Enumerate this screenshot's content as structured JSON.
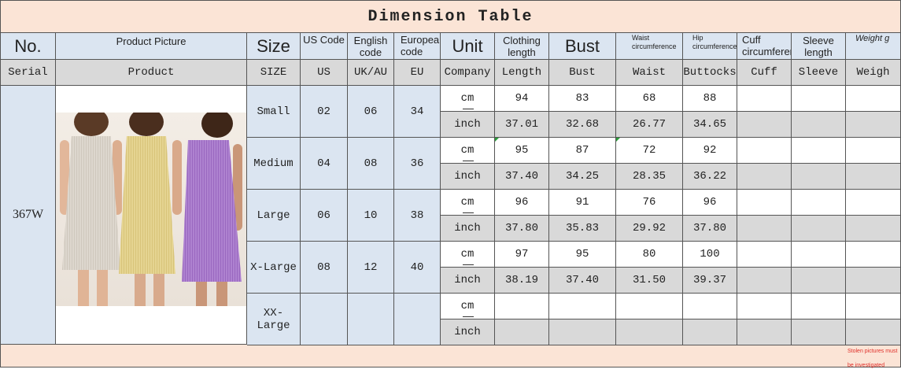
{
  "title": "Dimension Table",
  "header": {
    "no": "No.",
    "product_picture": "Product Picture",
    "size": "Size",
    "us_code": "US Code",
    "english_code": "English code",
    "european_code": "European code",
    "unit": "Unit",
    "clothing_length": "Clothing length",
    "bust": "Bust",
    "waist": "Waist circumference",
    "hip": "Hip circumference",
    "cuff": "Cuff circumference",
    "sleeve": "Sleeve length",
    "weight": "Weight g"
  },
  "subheader": {
    "serial": "Serial",
    "product": "Product",
    "size": "SIZE",
    "us": "US",
    "uk_au": "UK/AU",
    "eu": "EU",
    "company": "Company",
    "length": "Length",
    "bust": "Bust",
    "waist": "Waist",
    "buttocks": "Buttocks",
    "cuff": "Cuff",
    "sleeve": "Sleeve",
    "weigh": "Weigh"
  },
  "serial_value": "367W",
  "units": {
    "cm": "cm",
    "inch": "inch"
  },
  "rows": [
    {
      "size": "Small",
      "us": "02",
      "uk": "06",
      "eu": "34",
      "cm": [
        "94",
        "83",
        "68",
        "88"
      ],
      "inch": [
        "37.01",
        "32.68",
        "26.77",
        "34.65"
      ]
    },
    {
      "size": "Medium",
      "us": "04",
      "uk": "08",
      "eu": "36",
      "cm": [
        "95",
        "87",
        "72",
        "92"
      ],
      "inch": [
        "37.40",
        "34.25",
        "28.35",
        "36.22"
      ]
    },
    {
      "size": "Large",
      "us": "06",
      "uk": "10",
      "eu": "38",
      "cm": [
        "96",
        "91",
        "76",
        "96"
      ],
      "inch": [
        "37.80",
        "35.83",
        "29.92",
        "37.80"
      ]
    },
    {
      "size": "X-Large",
      "us": "08",
      "uk": "12",
      "eu": "40",
      "cm": [
        "97",
        "95",
        "80",
        "100"
      ],
      "inch": [
        "38.19",
        "37.40",
        "31.50",
        "39.37"
      ]
    },
    {
      "size": "XX-Large",
      "us": "",
      "uk": "",
      "eu": "",
      "cm": [
        "",
        "",
        "",
        ""
      ],
      "inch": [
        "",
        "",
        "",
        ""
      ]
    }
  ],
  "footer_note": "Stolen pictures must be investigated",
  "colors": {
    "peach": "#fbe4d6",
    "blue": "#dbe5f1",
    "gray": "#d9d9d9",
    "note_red": "#e0302a"
  },
  "product_image": {
    "dress_colors": [
      "#d8d2c8",
      "#e2d08a",
      "#a678c8"
    ]
  }
}
